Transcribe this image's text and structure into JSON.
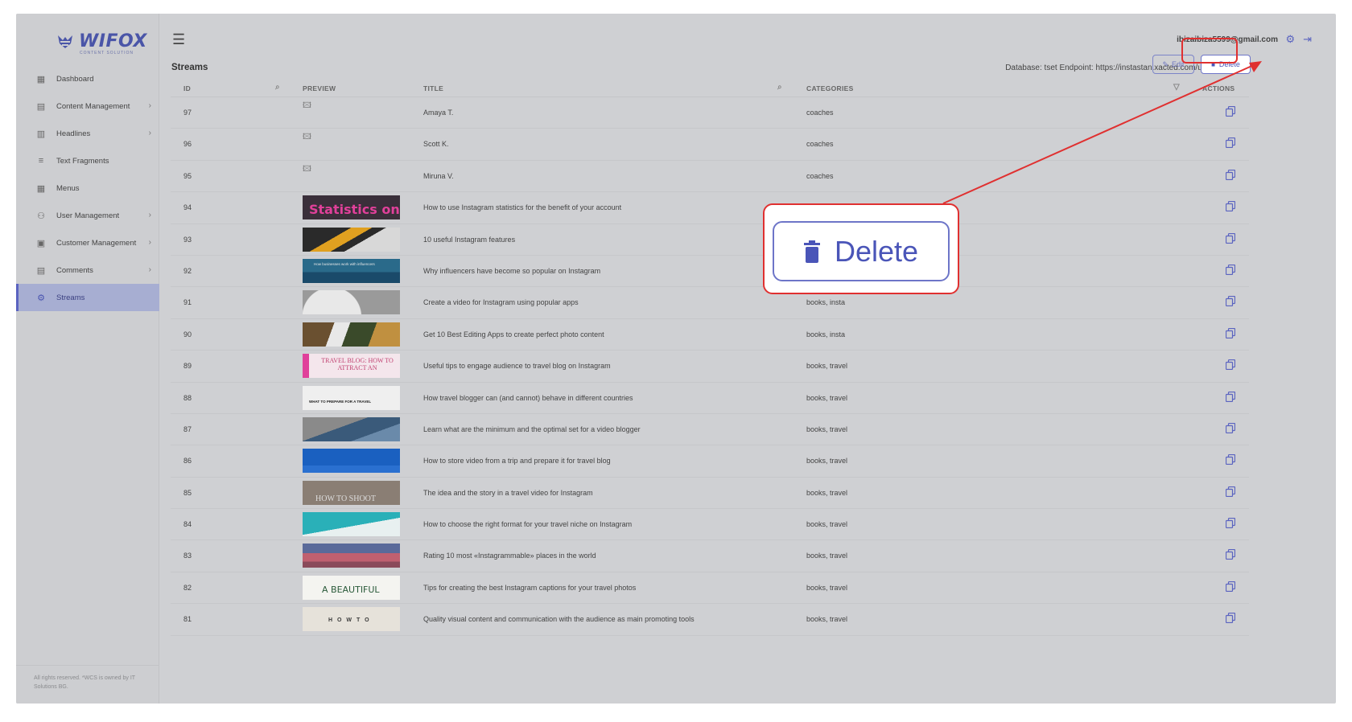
{
  "brand": {
    "name": "WIFOX",
    "tagline": "CONTENT SOLUTION"
  },
  "sidebar": {
    "items": [
      {
        "label": "Dashboard",
        "icon": "dashboard-icon",
        "has_chevron": false,
        "active": false
      },
      {
        "label": "Content Management",
        "icon": "content-icon",
        "has_chevron": true,
        "active": false
      },
      {
        "label": "Headlines",
        "icon": "headlines-icon",
        "has_chevron": true,
        "active": false
      },
      {
        "label": "Text Fragments",
        "icon": "text-icon",
        "has_chevron": false,
        "active": false
      },
      {
        "label": "Menus",
        "icon": "menus-icon",
        "has_chevron": false,
        "active": false
      },
      {
        "label": "User Management",
        "icon": "users-icon",
        "has_chevron": true,
        "active": false
      },
      {
        "label": "Customer Management",
        "icon": "customer-icon",
        "has_chevron": true,
        "active": false
      },
      {
        "label": "Comments",
        "icon": "comments-icon",
        "has_chevron": true,
        "active": false
      },
      {
        "label": "Streams",
        "icon": "gear-icon",
        "has_chevron": false,
        "active": true
      }
    ],
    "footer": "All rights reserved. *WCS is owned by IT Solutions BG."
  },
  "header": {
    "user_email": "ibizaibiza5599@gmail.com"
  },
  "page": {
    "title": "Streams",
    "db_info": "Database: tset   Endpoint: https://instastan.xacted.com/ui",
    "edit_label": "Edit",
    "delete_label": "Delete"
  },
  "table": {
    "columns": {
      "id": "ID",
      "preview": "PREVIEW",
      "title": "TITLE",
      "categories": "CATEGORIES",
      "actions": "ACTIONS"
    },
    "rows": [
      {
        "id": "97",
        "title": "Amaya T.",
        "categories": "coaches",
        "preview": "broken"
      },
      {
        "id": "96",
        "title": "Scott K.",
        "categories": "coaches",
        "preview": "broken"
      },
      {
        "id": "95",
        "title": "Miruna V.",
        "categories": "coaches",
        "preview": "broken"
      },
      {
        "id": "94",
        "title": "How to use Instagram statistics for the benefit of your account",
        "categories": "",
        "preview": "stats",
        "thumb_text": "Statistics on"
      },
      {
        "id": "93",
        "title": "10 useful Instagram features",
        "categories": "",
        "preview": "stripe"
      },
      {
        "id": "92",
        "title": "Why influencers have become so popular on Instagram",
        "categories": "",
        "preview": "influencer",
        "thumb_text": "How businesses work with influencers"
      },
      {
        "id": "91",
        "title": "Create a video for Instagram using popular apps",
        "categories": "books, insta",
        "preview": "gray"
      },
      {
        "id": "90",
        "title": "Get 10 Best Editing Apps to create perfect photo content",
        "categories": "books, insta",
        "preview": "photo"
      },
      {
        "id": "89",
        "title": "Useful tips to engage audience to travel blog on Instagram",
        "categories": "books, travel",
        "preview": "pinktext",
        "thumb_text": "TRAVEL BLOG: HOW TO ATTRACT AN"
      },
      {
        "id": "88",
        "title": "How travel blogger can (and cannot) behave in different countries",
        "categories": "books, travel",
        "preview": "whattext",
        "thumb_text": "WHAT TO PREPARE FOR A TRAVEL"
      },
      {
        "id": "87",
        "title": "Learn what are the minimum and the optimal set for a video blogger",
        "categories": "books, travel",
        "preview": "mountain"
      },
      {
        "id": "86",
        "title": "How to store video from a trip and prepare it for travel blog",
        "categories": "books, travel",
        "preview": "blue"
      },
      {
        "id": "85",
        "title": "The idea and the story in a travel video for Instagram",
        "categories": "books, travel",
        "preview": "shoot",
        "thumb_text": "HOW TO SHOOT"
      },
      {
        "id": "84",
        "title": "How to choose the right format for your travel niche on Instagram",
        "categories": "books, travel",
        "preview": "teal"
      },
      {
        "id": "83",
        "title": "Rating 10 most «Instagrammable» places in the world",
        "categories": "books, travel",
        "preview": "sunset"
      },
      {
        "id": "82",
        "title": "Tips for creating the best Instagram captions for your travel photos",
        "categories": "books, travel",
        "preview": "beautiful",
        "thumb_text": "A BEAUTIFUL"
      },
      {
        "id": "81",
        "title": "Quality visual content and communication with the audience as main promoting tools",
        "categories": "books, travel",
        "preview": "howto",
        "thumb_text": "H O W   T O"
      }
    ]
  },
  "callout": {
    "label": "Delete"
  },
  "colors": {
    "accent": "#5a63c0",
    "highlight": "#e03030"
  }
}
